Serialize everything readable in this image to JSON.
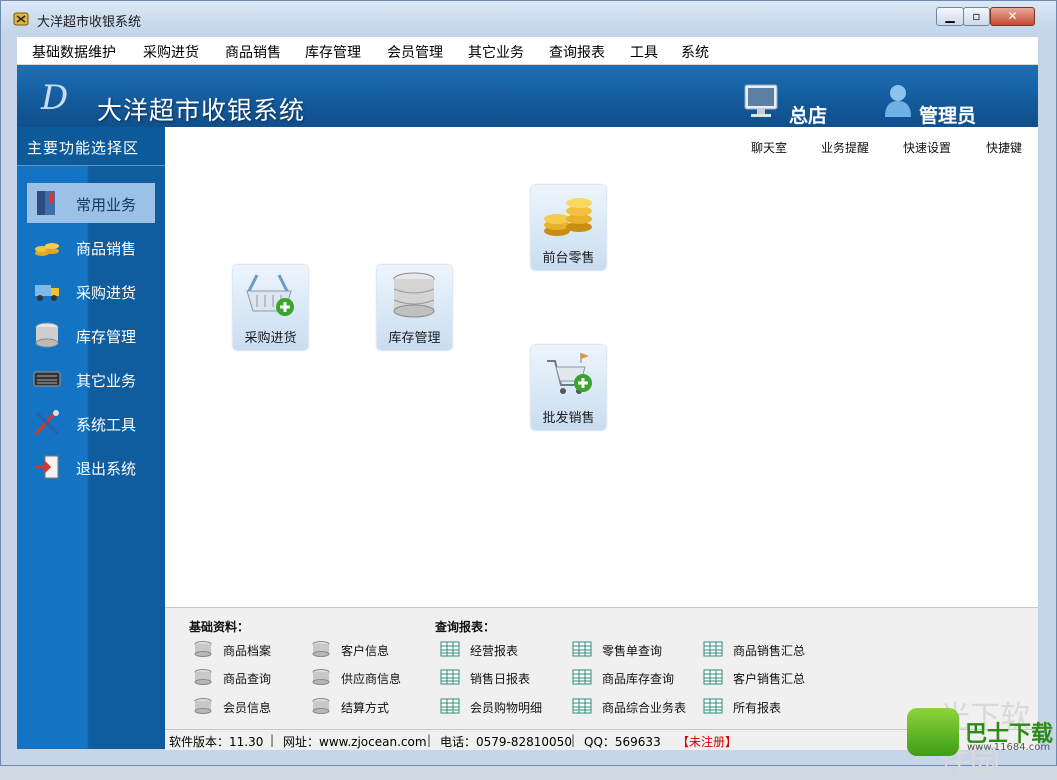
{
  "window": {
    "title": "大洋超市收银系统"
  },
  "menu": [
    "基础数据维护",
    "采购进货",
    "商品销售",
    "库存管理",
    "会员管理",
    "其它业务",
    "查询报表",
    "工具",
    "系统"
  ],
  "banner": {
    "logo": "D",
    "title": "大洋超市收银系统",
    "store": "总店",
    "user": "管理员"
  },
  "sidebar": {
    "header": "主要功能选择区",
    "items": [
      {
        "label": "常用业务",
        "icon": "book-icon",
        "active": true
      },
      {
        "label": "商品销售",
        "icon": "coins-icon"
      },
      {
        "label": "采购进货",
        "icon": "truck-icon"
      },
      {
        "label": "库存管理",
        "icon": "database-icon"
      },
      {
        "label": "其它业务",
        "icon": "keyboard-icon"
      },
      {
        "label": "系统工具",
        "icon": "tools-icon"
      },
      {
        "label": "退出系统",
        "icon": "exit-icon"
      }
    ]
  },
  "toplinks": [
    "聊天室",
    "业务提醒",
    "快速设置",
    "快捷键"
  ],
  "tiles": {
    "retail": "前台零售",
    "purchase": "采购进货",
    "inventory": "库存管理",
    "wholesale": "批发销售"
  },
  "quick": {
    "basic_header": "基础资料：",
    "report_header": "查询报表：",
    "basic_col1": [
      "商品档案",
      "商品查询",
      "会员信息"
    ],
    "basic_col2": [
      "客户信息",
      "供应商信息",
      "结算方式"
    ],
    "report_col1": [
      "经营报表",
      "销售日报表",
      "会员购物明细"
    ],
    "report_col2": [
      "零售单查询",
      "商品库存查询",
      "商品综合业务表"
    ],
    "report_col3": [
      "商品销售汇总",
      "客户销售汇总",
      "所有报表"
    ]
  },
  "status": {
    "version": "软件版本：11.30",
    "website": "网址：www.zjocean.com",
    "phone": "电话：0579-82810050",
    "qq": "QQ：569633",
    "reg": "【未注册】"
  },
  "watermark": {
    "name": "巴士下载",
    "url": "www.11684.com",
    "faint": "光下软件园"
  },
  "colors": {
    "banner": "#135a9b",
    "sidebar": "#1475c4",
    "unregistered": "#d40000"
  }
}
